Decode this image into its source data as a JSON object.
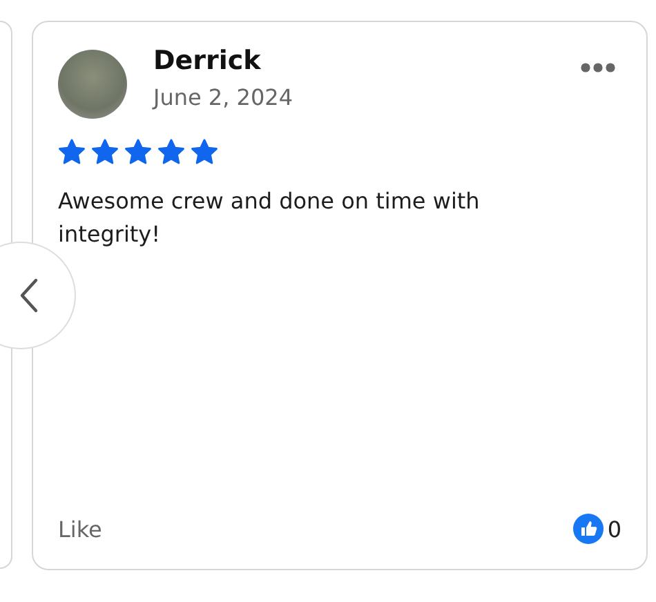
{
  "review": {
    "author": "Derrick",
    "date": "June 2, 2024",
    "stars": 5,
    "text": "Awesome crew and done on time with integrity!",
    "like_label": "Like",
    "like_count": "0"
  }
}
